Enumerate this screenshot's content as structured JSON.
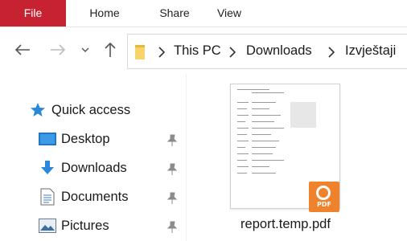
{
  "ribbon": {
    "tabs": [
      "File",
      "Home",
      "Share",
      "View"
    ]
  },
  "address_bar": {
    "breadcrumbs": [
      "This PC",
      "Downloads",
      "Izvještaji"
    ]
  },
  "nav_pane": {
    "quick_access": "Quick access",
    "items": [
      {
        "label": "Desktop",
        "icon": "desktop-icon",
        "pinned": true
      },
      {
        "label": "Downloads",
        "icon": "downloads-icon",
        "pinned": true
      },
      {
        "label": "Documents",
        "icon": "documents-icon",
        "pinned": true
      },
      {
        "label": "Pictures",
        "icon": "pictures-icon",
        "pinned": true
      }
    ]
  },
  "files": [
    {
      "name": "report.temp.pdf",
      "badge": "PDF"
    }
  ],
  "colors": {
    "file_tab": "#c62232",
    "pdf_badge": "#f0822b",
    "quick_access_star": "#2b88d8"
  }
}
